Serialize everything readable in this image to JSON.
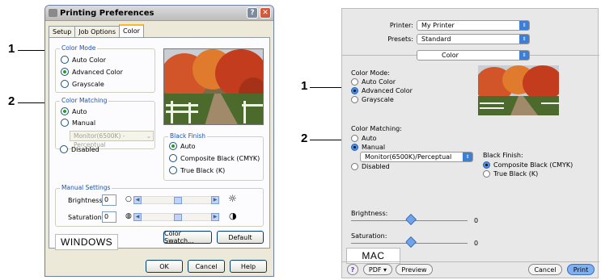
{
  "callouts": {
    "one": "1",
    "two": "2"
  },
  "windows": {
    "title": "Printing Preferences",
    "tabs": [
      "Setup",
      "Job Options",
      "Color"
    ],
    "color_mode": {
      "legend": "Color Mode",
      "options": [
        "Auto Color",
        "Advanced Color",
        "Grayscale"
      ],
      "selected": "Advanced Color"
    },
    "color_matching": {
      "legend": "Color Matching",
      "options": [
        "Auto",
        "Manual",
        "Disabled"
      ],
      "selected": "Auto",
      "profile": "Monitor(6500K) - Perceptual"
    },
    "black_finish": {
      "legend": "Black Finish",
      "options": [
        "Auto",
        "Composite Black (CMYK)",
        "True Black (K)"
      ],
      "selected": "Auto"
    },
    "manual_settings": {
      "legend": "Manual Settings",
      "brightness_label": "Brightness:",
      "brightness_value": "0",
      "saturation_label": "Saturation:",
      "saturation_value": "0"
    },
    "buttons": {
      "color_swatch": "Color Swatch...",
      "default": "Default",
      "ok": "OK",
      "cancel": "Cancel",
      "help": "Help"
    },
    "os_label": "WINDOWS"
  },
  "mac": {
    "printer_label": "Printer:",
    "printer_value": "My Printer",
    "presets_label": "Presets:",
    "presets_value": "Standard",
    "panel_value": "Color",
    "color_mode": {
      "label": "Color Mode:",
      "options": [
        "Auto Color",
        "Advanced Color",
        "Grayscale"
      ],
      "selected": "Advanced Color"
    },
    "color_matching": {
      "label": "Color Matching:",
      "options": [
        "Auto",
        "Manual",
        "Disabled"
      ],
      "selected": "Manual",
      "profile": "Monitor(6500K)/Perceptual"
    },
    "black_finish": {
      "label": "Black Finish:",
      "options": [
        "Composite Black (CMYK)",
        "True Black (K)"
      ],
      "selected": "Composite Black (CMYK)"
    },
    "brightness_label": "Brightness:",
    "brightness_value": "0",
    "saturation_label": "Saturation:",
    "saturation_value": "0",
    "buttons": {
      "help": "?",
      "pdf": "PDF ▾",
      "preview": "Preview",
      "cancel": "Cancel",
      "print": "Print"
    },
    "os_label": "MAC"
  }
}
